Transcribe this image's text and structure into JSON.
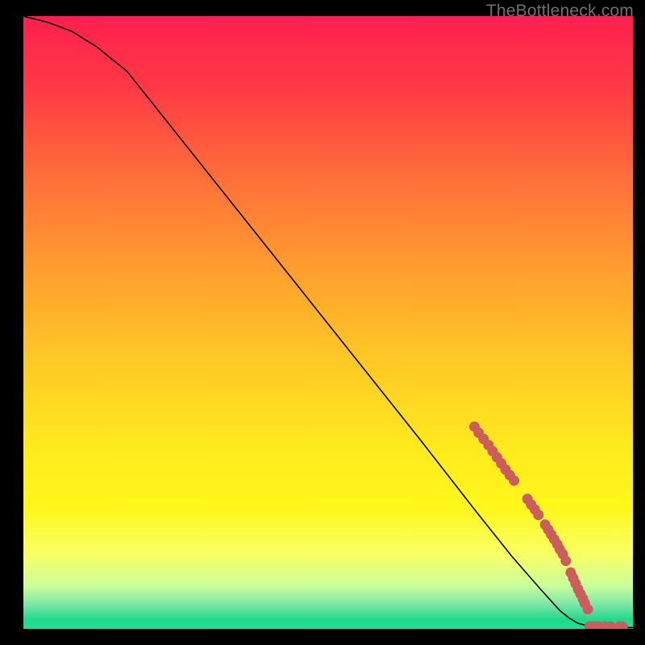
{
  "watermark": "TheBottleneck.com",
  "chart_data": {
    "type": "line",
    "title": "",
    "xlabel": "",
    "ylabel": "",
    "xlim": [
      0,
      100
    ],
    "ylim": [
      0,
      100
    ],
    "background": {
      "type": "vertical-gradient",
      "stops": [
        {
          "pos": 0.0,
          "color": "#ff1f4f"
        },
        {
          "pos": 0.12,
          "color": "#ff3a45"
        },
        {
          "pos": 0.25,
          "color": "#ff6a3a"
        },
        {
          "pos": 0.4,
          "color": "#ff9a30"
        },
        {
          "pos": 0.55,
          "color": "#ffc526"
        },
        {
          "pos": 0.7,
          "color": "#ffe91e"
        },
        {
          "pos": 0.8,
          "color": "#fff71a"
        },
        {
          "pos": 0.88,
          "color": "#f8ff66"
        },
        {
          "pos": 0.93,
          "color": "#c8ff9a"
        },
        {
          "pos": 0.96,
          "color": "#7de6a8"
        },
        {
          "pos": 0.985,
          "color": "#1fd98a"
        },
        {
          "pos": 1.0,
          "color": "#18e39a"
        }
      ]
    },
    "series": [
      {
        "name": "bottleneck-curve",
        "color": "#000000",
        "x": [
          0,
          4,
          8,
          12,
          17,
          25,
          35,
          45,
          55,
          65,
          74,
          80,
          85,
          88,
          89.5,
          91,
          93,
          95,
          97,
          99,
          100
        ],
        "y": [
          100,
          99,
          97.5,
          95,
          91,
          81,
          68.5,
          56,
          43.5,
          31,
          19.5,
          12,
          6.3,
          3,
          1.8,
          0.9,
          0.4,
          0.25,
          0.2,
          0.2,
          0.2
        ]
      }
    ],
    "scatter": {
      "name": "highlight-points",
      "color": "#cd5c5c",
      "radius": 6.5,
      "points": [
        {
          "x": 74.0,
          "y": 33.0
        },
        {
          "x": 74.7,
          "y": 32.0
        },
        {
          "x": 75.5,
          "y": 31.0
        },
        {
          "x": 76.3,
          "y": 30.0
        },
        {
          "x": 77.0,
          "y": 29.0
        },
        {
          "x": 77.7,
          "y": 28.0
        },
        {
          "x": 78.4,
          "y": 27.0
        },
        {
          "x": 79.1,
          "y": 26.0
        },
        {
          "x": 79.8,
          "y": 25.1
        },
        {
          "x": 80.5,
          "y": 24.2
        },
        {
          "x": 82.7,
          "y": 21.2
        },
        {
          "x": 83.3,
          "y": 20.3
        },
        {
          "x": 83.9,
          "y": 19.5
        },
        {
          "x": 84.5,
          "y": 18.6
        },
        {
          "x": 85.6,
          "y": 17.0
        },
        {
          "x": 86.1,
          "y": 16.2
        },
        {
          "x": 86.6,
          "y": 15.4
        },
        {
          "x": 87.1,
          "y": 14.6
        },
        {
          "x": 87.6,
          "y": 13.8
        },
        {
          "x": 88.0,
          "y": 13.0
        },
        {
          "x": 88.5,
          "y": 12.2
        },
        {
          "x": 89.0,
          "y": 11.1
        },
        {
          "x": 89.8,
          "y": 9.2
        },
        {
          "x": 90.2,
          "y": 8.3
        },
        {
          "x": 90.6,
          "y": 7.4
        },
        {
          "x": 91.0,
          "y": 6.5
        },
        {
          "x": 91.4,
          "y": 5.7
        },
        {
          "x": 91.8,
          "y": 4.9
        },
        {
          "x": 92.1,
          "y": 4.2
        },
        {
          "x": 92.6,
          "y": 3.2
        },
        {
          "x": 92.9,
          "y": 0.4
        },
        {
          "x": 93.3,
          "y": 0.4
        },
        {
          "x": 93.7,
          "y": 0.4
        },
        {
          "x": 94.1,
          "y": 0.4
        },
        {
          "x": 94.5,
          "y": 0.4
        },
        {
          "x": 95.4,
          "y": 0.4
        },
        {
          "x": 96.3,
          "y": 0.4
        },
        {
          "x": 97.8,
          "y": 0.4
        },
        {
          "x": 98.3,
          "y": 0.4
        }
      ]
    }
  }
}
